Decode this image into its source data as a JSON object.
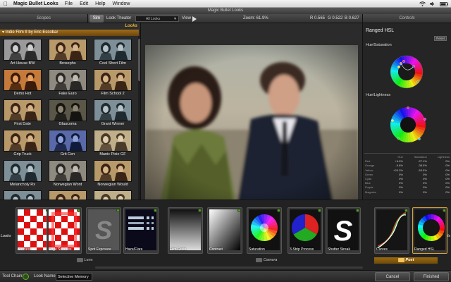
{
  "menubar": {
    "app_name": "Magic Bullet Looks",
    "items": [
      "File",
      "Edit",
      "Help",
      "Window"
    ],
    "apple_icon": "apple-icon",
    "tray_icons": [
      "wifi-icon",
      "volume-icon",
      "battery-icon"
    ]
  },
  "window": {
    "title": "Magic Bullet Looks"
  },
  "header": {
    "scopes_label": "Scopes",
    "sim_label": "Sim",
    "look_theater_label": "Look Theater",
    "look_theater_value": "All Looks",
    "view_label": "View",
    "zoom": "Zoom:  61.9%",
    "r_value": "R  0.565",
    "g_value": "G  0.522",
    "b_value": "B  0.627",
    "controls_label": "Controls"
  },
  "looks": {
    "panel_title": "Looks",
    "category": "Indie Film II by Eric Escobar",
    "items": [
      {
        "label": "Art House BW",
        "tone": "bw"
      },
      {
        "label": "Brosephs",
        "tone": "warm"
      },
      {
        "label": "Cool Short Film",
        "tone": "cool"
      },
      {
        "label": "Demo Hot",
        "tone": "hot"
      },
      {
        "label": "Fake Euro",
        "tone": "desat"
      },
      {
        "label": "Film School 2",
        "tone": "warm"
      },
      {
        "label": "First Date",
        "tone": "warm"
      },
      {
        "label": "Glaucoma",
        "tone": "dark"
      },
      {
        "label": "Grant Winner",
        "tone": "cool"
      },
      {
        "label": "Grip Truck",
        "tone": "warm"
      },
      {
        "label": "Grit Cen",
        "tone": "blue"
      },
      {
        "label": "Manic Pixie GF",
        "tone": "soft"
      },
      {
        "label": "Melancholy Rx",
        "tone": "cool"
      },
      {
        "label": "Norwegian Wont",
        "tone": "desat"
      },
      {
        "label": "Norwegian Would",
        "tone": "warm"
      },
      {
        "label": "",
        "tone": "cool"
      },
      {
        "label": "",
        "tone": "warm"
      },
      {
        "label": "",
        "tone": "soft"
      }
    ]
  },
  "controls": {
    "title": "Ranged HSL",
    "reset_label": "Reset",
    "hue_saturation_label": "Hue/Saturation",
    "hue_lightness_label": "Hue/Lightness",
    "table_headers": [
      "",
      "Hue",
      "Saturation",
      "Lightness"
    ],
    "table_rows": [
      [
        "Red",
        "+6.9%",
        "-27.1%",
        "0%"
      ],
      [
        "Orange",
        "-9.8%",
        "-38.0%",
        "0%"
      ],
      [
        "Yellow",
        "+20.3%",
        "-53.5%",
        "0%"
      ],
      [
        "Green",
        "0%",
        "0%",
        "0%"
      ],
      [
        "Cyan",
        "0%",
        "0%",
        "0%"
      ],
      [
        "Blue",
        "0%",
        "0%",
        "0%"
      ],
      [
        "Purple",
        "0%",
        "0%",
        "0%"
      ],
      [
        "Magenta",
        "0%",
        "0%",
        "0%"
      ]
    ]
  },
  "toolchain": {
    "left_side_label": "Looks",
    "right_side_label": "Tools",
    "tools": [
      {
        "label": "Softness",
        "art": "checker-red"
      },
      {
        "label": "Edge Softness",
        "art": "checker-red-edge"
      },
      {
        "label": "Spot Exposure",
        "art": "s-gray"
      },
      {
        "label": "Haze/Flare",
        "art": "bars-blue"
      },
      {
        "label": "Film Grain",
        "art": "grain"
      },
      {
        "label": "Contrast",
        "art": "gradient"
      },
      {
        "label": "Saturation",
        "art": "colorwheel"
      },
      {
        "label": "3-Strip Process",
        "art": "rgb-circle"
      },
      {
        "label": "Shutter Streak",
        "art": "s-white"
      },
      {
        "label": "Curves",
        "art": "curves"
      },
      {
        "label": "Ranged HSL",
        "art": "hsl-ring"
      }
    ],
    "groups": {
      "lens": "Lens",
      "camera": "Camera",
      "post": "Post"
    }
  },
  "bottom": {
    "tool_chain_label": "Tool Chain:",
    "look_name_label": "Look Name:",
    "look_name_value": "Selective Memory",
    "cancel_label": "Cancel",
    "finished_label": "Finished"
  }
}
